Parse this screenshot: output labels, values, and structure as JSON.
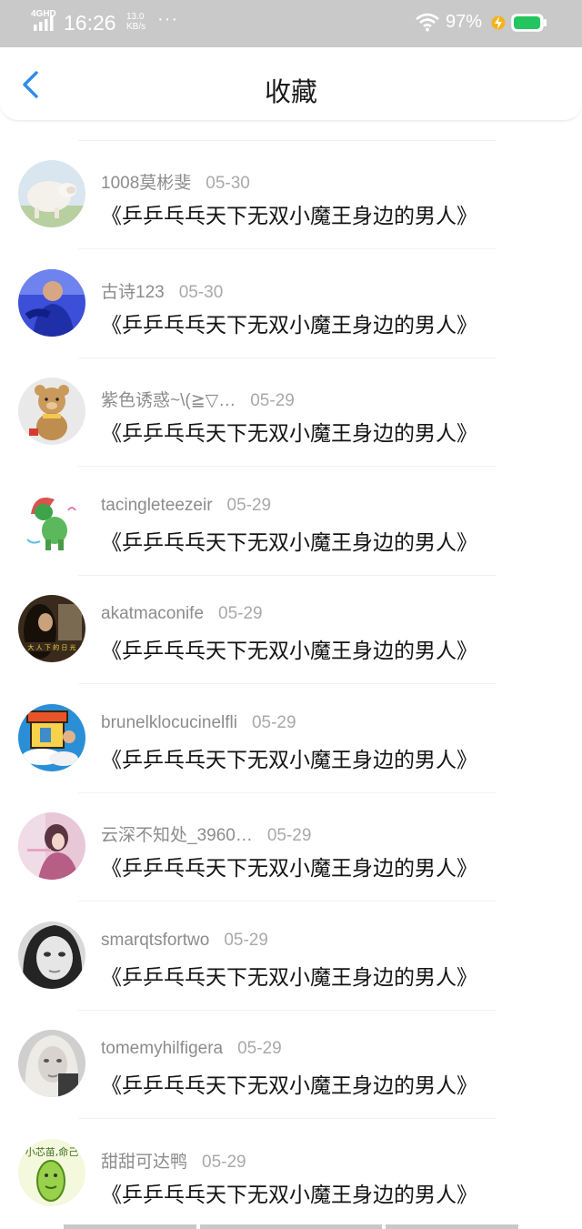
{
  "status_bar": {
    "network": "4GHD",
    "time": "16:26",
    "speed_value": "13.0",
    "speed_unit": "KB/s",
    "dots": "···",
    "battery_percent": "97%",
    "battery_level": 0.97,
    "colors": {
      "battery_fill": "#22c55e",
      "bolt": "#f5b31b"
    }
  },
  "header": {
    "title": "收藏",
    "back_icon": "chevron-left-icon",
    "accent": "#2d8cf0"
  },
  "items": [
    {
      "user": "1008莫彬斐",
      "date": "05-30",
      "title": "《乒乒乓乓天下无双小魔王身边的男人》",
      "avatar": "sheep"
    },
    {
      "user": "古诗123",
      "date": "05-30",
      "title": "《乒乒乓乓天下无双小魔王身边的男人》",
      "avatar": "blue-person"
    },
    {
      "user": "紫色诱惑~\\(≧▽…",
      "date": "05-29",
      "title": "《乒乒乓乓天下无双小魔王身边的男人》",
      "avatar": "teddy-bear"
    },
    {
      "user": "tacingleteezeir",
      "date": "05-29",
      "title": "《乒乒乓乓天下无双小魔王身边的男人》",
      "avatar": "cartoon-frog"
    },
    {
      "user": "akatmaconife",
      "date": "05-29",
      "title": "《乒乒乓乓天下无双小魔王身边的男人》",
      "avatar": "dark-portrait"
    },
    {
      "user": "brunelklocucinelfli",
      "date": "05-29",
      "title": "《乒乒乓乓天下无双小魔王身边的男人》",
      "avatar": "cartoon-house"
    },
    {
      "user": "云深不知处_3960…",
      "date": "05-29",
      "title": "《乒乒乓乓天下无双小魔王身边的男人》",
      "avatar": "pink-girl"
    },
    {
      "user": "smarqtsfortwo",
      "date": "05-29",
      "title": "《乒乒乓乓天下无双小魔王身边的男人》",
      "avatar": "grey-face"
    },
    {
      "user": "tomemyhilfigera",
      "date": "05-29",
      "title": "《乒乒乓乓天下无双小魔王身边的男人》",
      "avatar": "blonde-face"
    },
    {
      "user": "甜甜可达鸭",
      "date": "05-29",
      "title": "《乒乒乓乓天下无双小魔王身边的男人》",
      "avatar": "green-bean"
    }
  ]
}
